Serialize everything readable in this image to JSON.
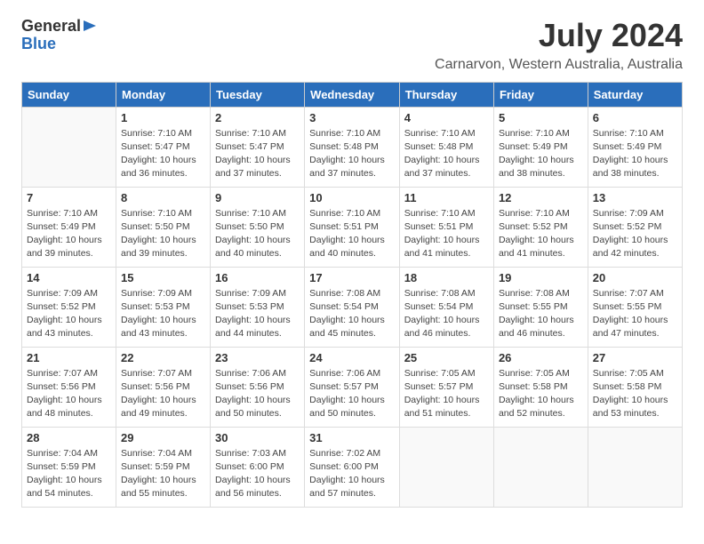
{
  "header": {
    "logo_general": "General",
    "logo_blue": "Blue",
    "month_year": "July 2024",
    "location": "Carnarvon, Western Australia, Australia"
  },
  "calendar": {
    "columns": [
      "Sunday",
      "Monday",
      "Tuesday",
      "Wednesday",
      "Thursday",
      "Friday",
      "Saturday"
    ],
    "weeks": [
      [
        {
          "day": "",
          "sunrise": "",
          "sunset": "",
          "daylight": "",
          "empty": true
        },
        {
          "day": "1",
          "sunrise": "Sunrise: 7:10 AM",
          "sunset": "Sunset: 5:47 PM",
          "daylight": "Daylight: 10 hours and 36 minutes."
        },
        {
          "day": "2",
          "sunrise": "Sunrise: 7:10 AM",
          "sunset": "Sunset: 5:47 PM",
          "daylight": "Daylight: 10 hours and 37 minutes."
        },
        {
          "day": "3",
          "sunrise": "Sunrise: 7:10 AM",
          "sunset": "Sunset: 5:48 PM",
          "daylight": "Daylight: 10 hours and 37 minutes."
        },
        {
          "day": "4",
          "sunrise": "Sunrise: 7:10 AM",
          "sunset": "Sunset: 5:48 PM",
          "daylight": "Daylight: 10 hours and 37 minutes."
        },
        {
          "day": "5",
          "sunrise": "Sunrise: 7:10 AM",
          "sunset": "Sunset: 5:49 PM",
          "daylight": "Daylight: 10 hours and 38 minutes."
        },
        {
          "day": "6",
          "sunrise": "Sunrise: 7:10 AM",
          "sunset": "Sunset: 5:49 PM",
          "daylight": "Daylight: 10 hours and 38 minutes."
        }
      ],
      [
        {
          "day": "7",
          "sunrise": "Sunrise: 7:10 AM",
          "sunset": "Sunset: 5:49 PM",
          "daylight": "Daylight: 10 hours and 39 minutes."
        },
        {
          "day": "8",
          "sunrise": "Sunrise: 7:10 AM",
          "sunset": "Sunset: 5:50 PM",
          "daylight": "Daylight: 10 hours and 39 minutes."
        },
        {
          "day": "9",
          "sunrise": "Sunrise: 7:10 AM",
          "sunset": "Sunset: 5:50 PM",
          "daylight": "Daylight: 10 hours and 40 minutes."
        },
        {
          "day": "10",
          "sunrise": "Sunrise: 7:10 AM",
          "sunset": "Sunset: 5:51 PM",
          "daylight": "Daylight: 10 hours and 40 minutes."
        },
        {
          "day": "11",
          "sunrise": "Sunrise: 7:10 AM",
          "sunset": "Sunset: 5:51 PM",
          "daylight": "Daylight: 10 hours and 41 minutes."
        },
        {
          "day": "12",
          "sunrise": "Sunrise: 7:10 AM",
          "sunset": "Sunset: 5:52 PM",
          "daylight": "Daylight: 10 hours and 41 minutes."
        },
        {
          "day": "13",
          "sunrise": "Sunrise: 7:09 AM",
          "sunset": "Sunset: 5:52 PM",
          "daylight": "Daylight: 10 hours and 42 minutes."
        }
      ],
      [
        {
          "day": "14",
          "sunrise": "Sunrise: 7:09 AM",
          "sunset": "Sunset: 5:52 PM",
          "daylight": "Daylight: 10 hours and 43 minutes."
        },
        {
          "day": "15",
          "sunrise": "Sunrise: 7:09 AM",
          "sunset": "Sunset: 5:53 PM",
          "daylight": "Daylight: 10 hours and 43 minutes."
        },
        {
          "day": "16",
          "sunrise": "Sunrise: 7:09 AM",
          "sunset": "Sunset: 5:53 PM",
          "daylight": "Daylight: 10 hours and 44 minutes."
        },
        {
          "day": "17",
          "sunrise": "Sunrise: 7:08 AM",
          "sunset": "Sunset: 5:54 PM",
          "daylight": "Daylight: 10 hours and 45 minutes."
        },
        {
          "day": "18",
          "sunrise": "Sunrise: 7:08 AM",
          "sunset": "Sunset: 5:54 PM",
          "daylight": "Daylight: 10 hours and 46 minutes."
        },
        {
          "day": "19",
          "sunrise": "Sunrise: 7:08 AM",
          "sunset": "Sunset: 5:55 PM",
          "daylight": "Daylight: 10 hours and 46 minutes."
        },
        {
          "day": "20",
          "sunrise": "Sunrise: 7:07 AM",
          "sunset": "Sunset: 5:55 PM",
          "daylight": "Daylight: 10 hours and 47 minutes."
        }
      ],
      [
        {
          "day": "21",
          "sunrise": "Sunrise: 7:07 AM",
          "sunset": "Sunset: 5:56 PM",
          "daylight": "Daylight: 10 hours and 48 minutes."
        },
        {
          "day": "22",
          "sunrise": "Sunrise: 7:07 AM",
          "sunset": "Sunset: 5:56 PM",
          "daylight": "Daylight: 10 hours and 49 minutes."
        },
        {
          "day": "23",
          "sunrise": "Sunrise: 7:06 AM",
          "sunset": "Sunset: 5:56 PM",
          "daylight": "Daylight: 10 hours and 50 minutes."
        },
        {
          "day": "24",
          "sunrise": "Sunrise: 7:06 AM",
          "sunset": "Sunset: 5:57 PM",
          "daylight": "Daylight: 10 hours and 50 minutes."
        },
        {
          "day": "25",
          "sunrise": "Sunrise: 7:05 AM",
          "sunset": "Sunset: 5:57 PM",
          "daylight": "Daylight: 10 hours and 51 minutes."
        },
        {
          "day": "26",
          "sunrise": "Sunrise: 7:05 AM",
          "sunset": "Sunset: 5:58 PM",
          "daylight": "Daylight: 10 hours and 52 minutes."
        },
        {
          "day": "27",
          "sunrise": "Sunrise: 7:05 AM",
          "sunset": "Sunset: 5:58 PM",
          "daylight": "Daylight: 10 hours and 53 minutes."
        }
      ],
      [
        {
          "day": "28",
          "sunrise": "Sunrise: 7:04 AM",
          "sunset": "Sunset: 5:59 PM",
          "daylight": "Daylight: 10 hours and 54 minutes."
        },
        {
          "day": "29",
          "sunrise": "Sunrise: 7:04 AM",
          "sunset": "Sunset: 5:59 PM",
          "daylight": "Daylight: 10 hours and 55 minutes."
        },
        {
          "day": "30",
          "sunrise": "Sunrise: 7:03 AM",
          "sunset": "Sunset: 6:00 PM",
          "daylight": "Daylight: 10 hours and 56 minutes."
        },
        {
          "day": "31",
          "sunrise": "Sunrise: 7:02 AM",
          "sunset": "Sunset: 6:00 PM",
          "daylight": "Daylight: 10 hours and 57 minutes."
        },
        {
          "day": "",
          "sunrise": "",
          "sunset": "",
          "daylight": "",
          "empty": true
        },
        {
          "day": "",
          "sunrise": "",
          "sunset": "",
          "daylight": "",
          "empty": true
        },
        {
          "day": "",
          "sunrise": "",
          "sunset": "",
          "daylight": "",
          "empty": true
        }
      ]
    ]
  }
}
